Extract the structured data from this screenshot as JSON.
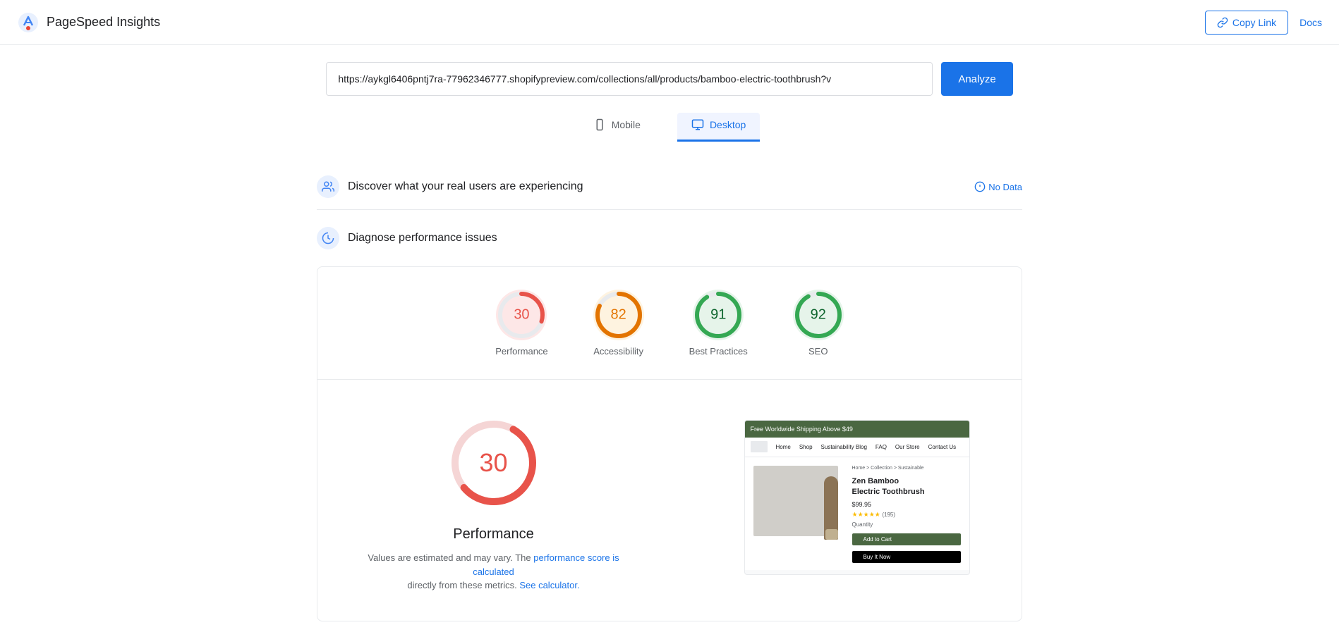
{
  "header": {
    "title": "PageSpeed Insights",
    "copy_link_label": "Copy Link",
    "docs_label": "Docs"
  },
  "search": {
    "url_value": "https://aykgl6406pntj7ra-77962346777.shopifypreview.com/collections/all/products/bamboo-electric-toothbrush?v",
    "analyze_label": "Analyze"
  },
  "mode_tabs": [
    {
      "label": "Mobile",
      "active": false
    },
    {
      "label": "Desktop",
      "active": true
    }
  ],
  "sections": {
    "real_users": {
      "title": "Discover what your real users are experiencing",
      "no_data_label": "No Data"
    },
    "diagnose": {
      "title": "Diagnose performance issues"
    }
  },
  "scores": [
    {
      "label": "Performance",
      "value": 30,
      "color": "red",
      "stroke": "red-stroke",
      "bg": "red-bg",
      "percent": 30
    },
    {
      "label": "Accessibility",
      "value": 82,
      "color": "orange",
      "stroke": "orange-stroke",
      "bg": "orange-bg",
      "percent": 82
    },
    {
      "label": "Best Practices",
      "value": 91,
      "color": "green",
      "stroke": "green-stroke",
      "bg": "green-bg",
      "percent": 91
    },
    {
      "label": "SEO",
      "value": 92,
      "color": "green",
      "stroke": "green-stroke",
      "bg": "green-bg",
      "percent": 92
    }
  ],
  "performance_detail": {
    "score": 30,
    "title": "Performance",
    "note_start": "Values are estimated and may vary. The",
    "note_link1": "performance score is calculated",
    "note_middle": "directly from these metrics.",
    "note_link2": "See calculator.",
    "note_end": ""
  },
  "screenshot": {
    "topbar_text": "Free Worldwide Shipping Above $49",
    "nav_items": [
      "Home",
      "Shop",
      "Sustainability Blog",
      "FAQ",
      "Our Store",
      "Contact Us"
    ],
    "breadcrumb": "Home > Collection > Sustainable Product > Zen Bamboo Electric Toothbrush",
    "product_title": "Zen Bamboo\nElectric Toothbrush",
    "price": "$99.95",
    "stars": "★★★★★",
    "review_count": "(195)",
    "quantity_label": "Quantity",
    "add_to_cart": "Add to Cart",
    "buy_now": "Buy It Now"
  }
}
